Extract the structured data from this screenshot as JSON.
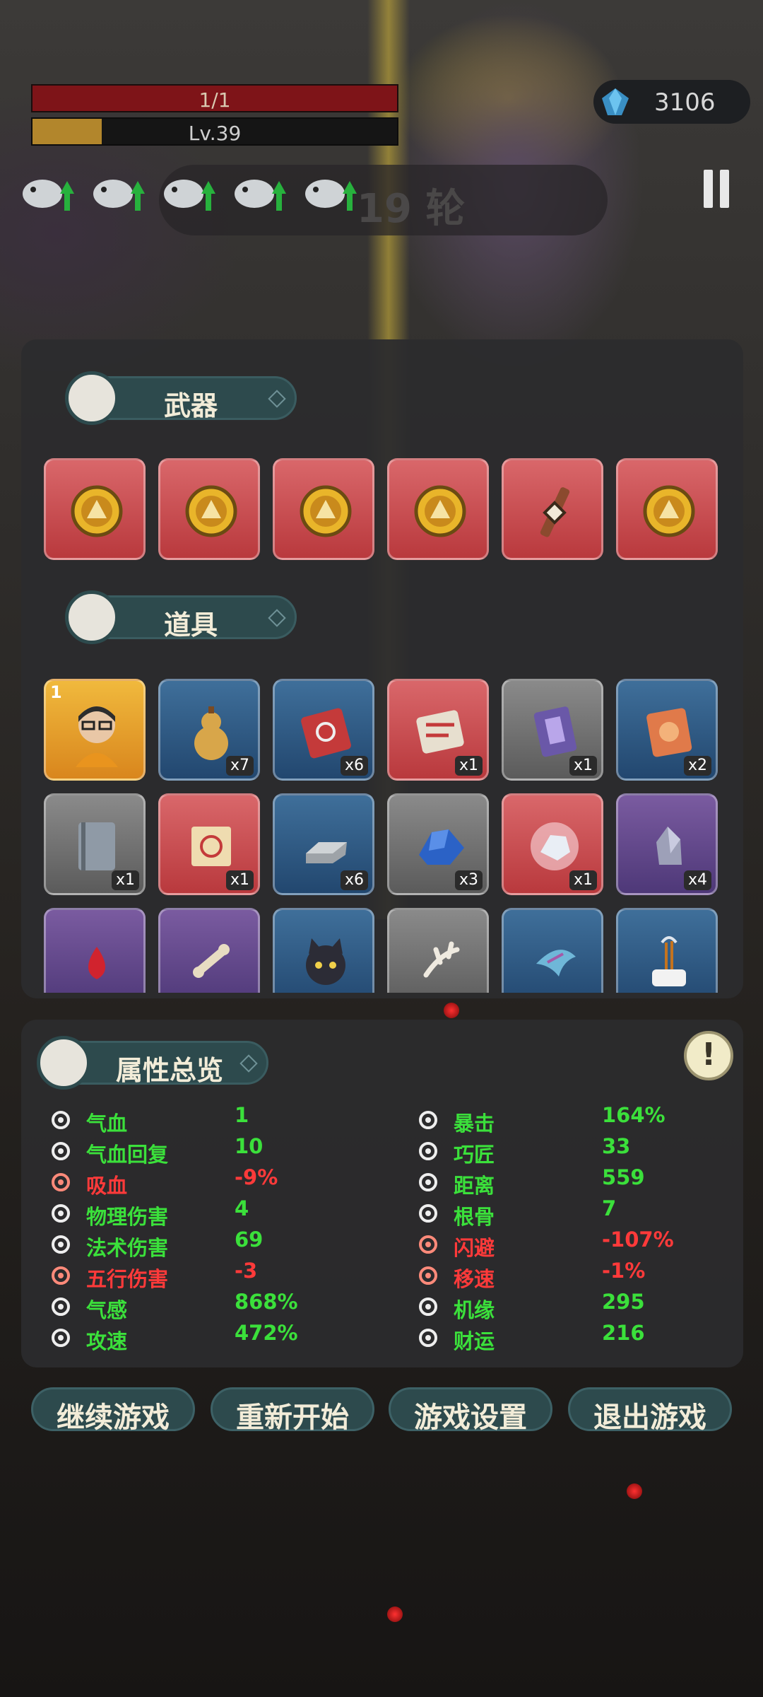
{
  "hud": {
    "hp_text": "1/1",
    "level_text": "Lv.39",
    "level_progress": 0.19,
    "gems": "3106",
    "round": "19 轮"
  },
  "weapons": {
    "title": "武器",
    "slots": [
      {
        "item": "gold-coin-icon",
        "color": "red"
      },
      {
        "item": "gold-coin-icon",
        "color": "red"
      },
      {
        "item": "gold-coin-icon",
        "color": "red"
      },
      {
        "item": "gold-coin-icon",
        "color": "red"
      },
      {
        "item": "crossbow-icon",
        "color": "red"
      },
      {
        "item": "gold-coin-icon",
        "color": "red"
      }
    ]
  },
  "items": {
    "title": "道具",
    "slots": [
      {
        "item": "portrait-icon",
        "color": "gold",
        "count": "",
        "level": "1"
      },
      {
        "item": "gourd-icon",
        "color": "blue",
        "count": "x7"
      },
      {
        "item": "red-book-icon",
        "color": "blue",
        "count": "x6"
      },
      {
        "item": "scroll-book-icon",
        "color": "red",
        "count": "x1"
      },
      {
        "item": "purple-book-icon",
        "color": "gray",
        "count": "x1"
      },
      {
        "item": "orange-book-icon",
        "color": "blue",
        "count": "x2"
      },
      {
        "item": "gray-book-icon",
        "color": "gray",
        "count": "x1"
      },
      {
        "item": "map-scroll-icon",
        "color": "red",
        "count": "x1"
      },
      {
        "item": "iron-ingot-icon",
        "color": "blue",
        "count": "x6"
      },
      {
        "item": "blue-ore-icon",
        "color": "gray",
        "count": "x3"
      },
      {
        "item": "white-crystal-icon",
        "color": "red",
        "count": "x1"
      },
      {
        "item": "gray-rock-icon",
        "color": "purple",
        "count": "x4"
      },
      {
        "item": "red-drop-icon",
        "color": "purple",
        "count": ""
      },
      {
        "item": "bone-icon",
        "color": "purple",
        "count": ""
      },
      {
        "item": "black-cat-icon",
        "color": "blue",
        "count": ""
      },
      {
        "item": "antler-icon",
        "color": "gray",
        "count": ""
      },
      {
        "item": "fin-icon",
        "color": "blue",
        "count": ""
      },
      {
        "item": "incense-icon",
        "color": "blue",
        "count": ""
      }
    ]
  },
  "attributes": {
    "title": "属性总览",
    "left": [
      {
        "icon": "heart-icon",
        "label": "气血",
        "value": "1",
        "color": "#3be03b"
      },
      {
        "icon": "heart-regen-icon",
        "label": "气血回复",
        "value": "10",
        "color": "#3be03b"
      },
      {
        "icon": "blood-drop-icon",
        "label": "吸血",
        "value": "-9%",
        "color": "#ff3a3a"
      },
      {
        "icon": "sword-icon",
        "label": "物理伤害",
        "value": "4",
        "color": "#3be03b"
      },
      {
        "icon": "swirl-icon",
        "label": "法术伤害",
        "value": "69",
        "color": "#3be03b"
      },
      {
        "icon": "elements-icon",
        "label": "五行伤害",
        "value": "-3",
        "color": "#ff3a3a"
      },
      {
        "icon": "qi-icon",
        "label": "气感",
        "value": "868%",
        "color": "#3be03b"
      },
      {
        "icon": "attack-speed-icon",
        "label": "攻速",
        "value": "472%",
        "color": "#3be03b"
      }
    ],
    "right": [
      {
        "icon": "crit-icon",
        "label": "暴击",
        "value": "164%",
        "color": "#3be03b"
      },
      {
        "icon": "hammer-icon",
        "label": "巧匠",
        "value": "33",
        "color": "#3be03b"
      },
      {
        "icon": "range-icon",
        "label": "距离",
        "value": "559",
        "color": "#3be03b"
      },
      {
        "icon": "meditate-icon",
        "label": "根骨",
        "value": "7",
        "color": "#3be03b"
      },
      {
        "icon": "dodge-icon",
        "label": "闪避",
        "value": "-107%",
        "color": "#ff3a3a"
      },
      {
        "icon": "boot-icon",
        "label": "移速",
        "value": "-1%",
        "color": "#ff3a3a"
      },
      {
        "icon": "luck-icon",
        "label": "机缘",
        "value": "295",
        "color": "#3be03b"
      },
      {
        "icon": "coin-icon",
        "label": "财运",
        "value": "216",
        "color": "#3be03b"
      }
    ]
  },
  "buttons": {
    "continue": "继续游戏",
    "restart": "重新开始",
    "settings": "游戏设置",
    "quit": "退出游戏"
  }
}
